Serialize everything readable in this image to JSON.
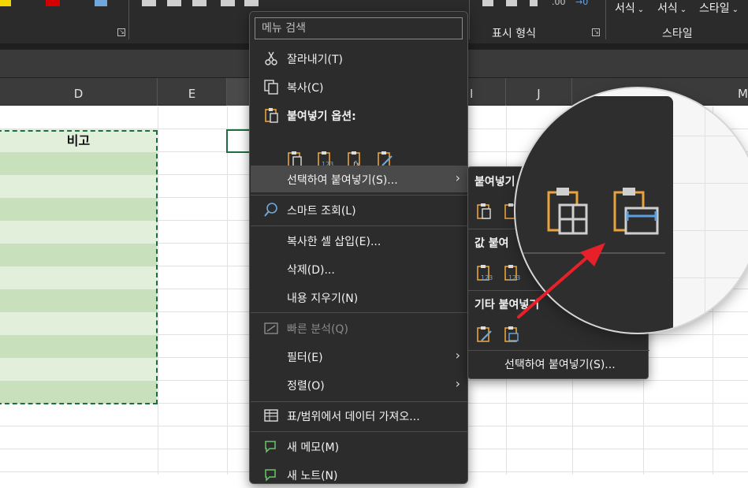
{
  "ribbon": {
    "number_format_label": "표시 형식",
    "styles_label": "스타일",
    "style_buttons": [
      "서식",
      "서식",
      "스타일"
    ],
    "decimal_increase": ".00",
    "decimal_decrease": "→0"
  },
  "columns": {
    "headers": [
      "D",
      "E",
      "I",
      "J",
      "M"
    ]
  },
  "sheet": {
    "d_header": "비고"
  },
  "context_menu": {
    "search_placeholder": "메뉴 검색",
    "items": {
      "cut": "잘라내기(T)",
      "copy": "복사(C)",
      "paste_options": "붙여넣기 옵션:",
      "paste_special": "선택하여 붙여넣기(S)...",
      "smart_lookup": "스마트 조회(L)",
      "insert_copied": "복사한 셀 삽입(E)...",
      "delete": "삭제(D)...",
      "clear_contents": "내용 지우기(N)",
      "quick_analysis": "빠른 분석(Q)",
      "filter": "필터(E)",
      "sort": "정렬(O)",
      "get_data": "표/범위에서 데이터 가져오...",
      "new_comment": "새 메모(M)",
      "new_note": "새 노트(N)"
    }
  },
  "submenu": {
    "paste_header": "붙여넣기",
    "values_header": "값 붙여",
    "other_header": "기타 붙여넣기",
    "paste_special": "선택하여 붙여넣기(S)..."
  },
  "colors": {
    "ribbon_bg": "#2b2b2b",
    "menu_bg": "#2c2c2c",
    "menu_text": "#f2f2f2",
    "accent_orange": "#e8a33d",
    "accent_blue": "#5aa0e0",
    "copy_border": "#1f6e43",
    "band_dark": "#c9e0bd",
    "band_light": "#e2efda",
    "annotation_red": "#e8202a"
  }
}
